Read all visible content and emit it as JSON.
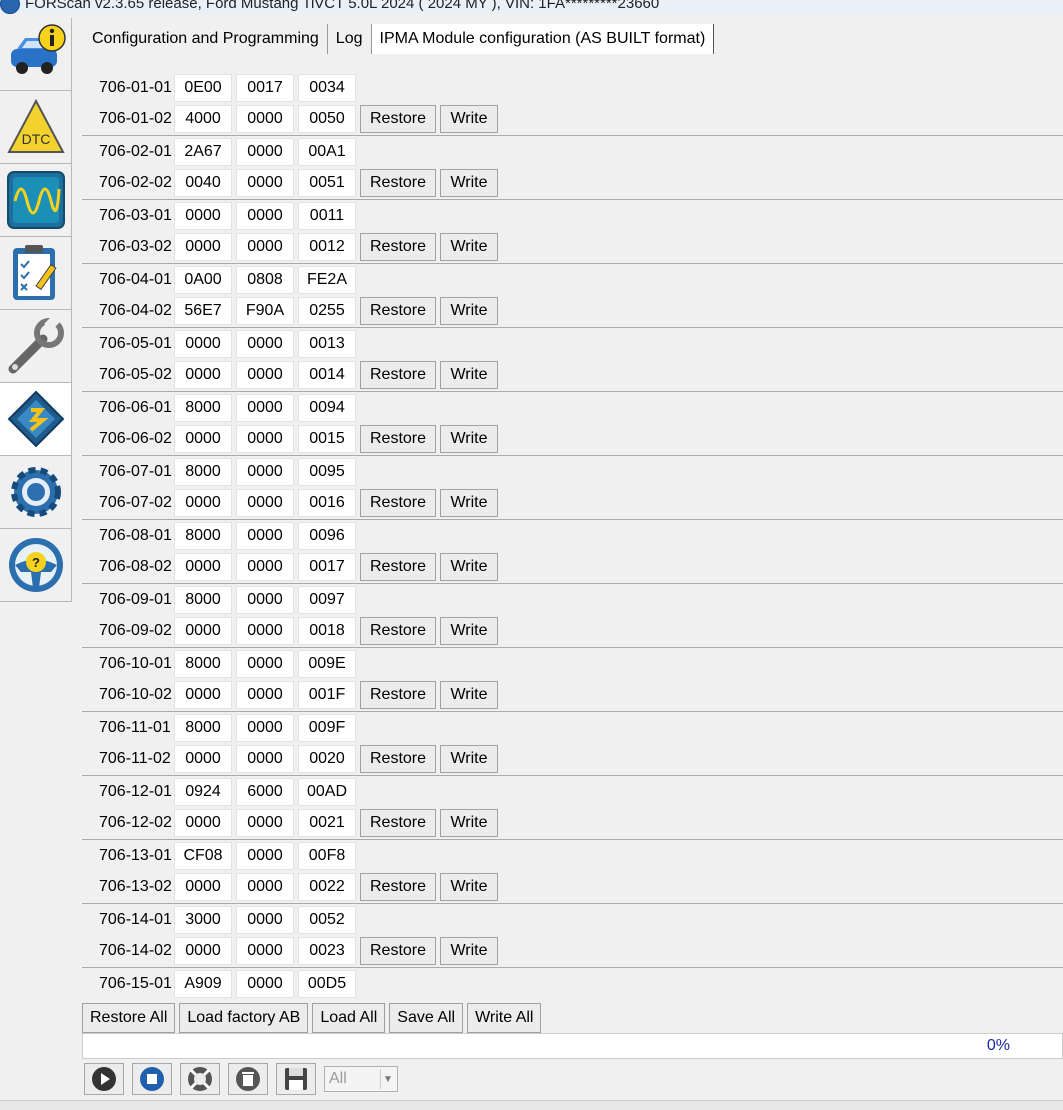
{
  "window": {
    "title": "FORScan v2.3.65 release, Ford Mustang TiVCT 5.0L 2024 ( 2024 MY ), VIN: 1FA*********23660"
  },
  "sidebar": {
    "items": [
      {
        "name": "vehicle-info"
      },
      {
        "name": "dtc"
      },
      {
        "name": "oscilloscope"
      },
      {
        "name": "tests-checklist"
      },
      {
        "name": "service-wrench"
      },
      {
        "name": "module-configuration",
        "active": true
      },
      {
        "name": "settings-gear"
      },
      {
        "name": "help"
      }
    ]
  },
  "tabs": [
    {
      "label": "Configuration and Programming"
    },
    {
      "label": "Log"
    },
    {
      "label": "IPMA Module configuration (AS BUILT format)",
      "active": true
    }
  ],
  "buttons": {
    "restore": "Restore",
    "write": "Write"
  },
  "rows": [
    {
      "a1": "706-01-01",
      "v1": [
        "0E00",
        "0017",
        "0034"
      ],
      "a2": "706-01-02",
      "v2": [
        "4000",
        "0000",
        "0050"
      ]
    },
    {
      "a1": "706-02-01",
      "v1": [
        "2A67",
        "0000",
        "00A1"
      ],
      "a2": "706-02-02",
      "v2": [
        "0040",
        "0000",
        "0051"
      ]
    },
    {
      "a1": "706-03-01",
      "v1": [
        "0000",
        "0000",
        "0011"
      ],
      "a2": "706-03-02",
      "v2": [
        "0000",
        "0000",
        "0012"
      ]
    },
    {
      "a1": "706-04-01",
      "v1": [
        "0A00",
        "0808",
        "FE2A"
      ],
      "a2": "706-04-02",
      "v2": [
        "56E7",
        "F90A",
        "0255"
      ]
    },
    {
      "a1": "706-05-01",
      "v1": [
        "0000",
        "0000",
        "0013"
      ],
      "a2": "706-05-02",
      "v2": [
        "0000",
        "0000",
        "0014"
      ]
    },
    {
      "a1": "706-06-01",
      "v1": [
        "8000",
        "0000",
        "0094"
      ],
      "a2": "706-06-02",
      "v2": [
        "0000",
        "0000",
        "0015"
      ]
    },
    {
      "a1": "706-07-01",
      "v1": [
        "8000",
        "0000",
        "0095"
      ],
      "a2": "706-07-02",
      "v2": [
        "0000",
        "0000",
        "0016"
      ]
    },
    {
      "a1": "706-08-01",
      "v1": [
        "8000",
        "0000",
        "0096"
      ],
      "a2": "706-08-02",
      "v2": [
        "0000",
        "0000",
        "0017"
      ]
    },
    {
      "a1": "706-09-01",
      "v1": [
        "8000",
        "0000",
        "0097"
      ],
      "a2": "706-09-02",
      "v2": [
        "0000",
        "0000",
        "0018"
      ]
    },
    {
      "a1": "706-10-01",
      "v1": [
        "8000",
        "0000",
        "009E"
      ],
      "a2": "706-10-02",
      "v2": [
        "0000",
        "0000",
        "001F"
      ]
    },
    {
      "a1": "706-11-01",
      "v1": [
        "8000",
        "0000",
        "009F"
      ],
      "a2": "706-11-02",
      "v2": [
        "0000",
        "0000",
        "0020"
      ]
    },
    {
      "a1": "706-12-01",
      "v1": [
        "0924",
        "6000",
        "00AD"
      ],
      "a2": "706-12-02",
      "v2": [
        "0000",
        "0000",
        "0021"
      ]
    },
    {
      "a1": "706-13-01",
      "v1": [
        "CF08",
        "0000",
        "00F8"
      ],
      "a2": "706-13-02",
      "v2": [
        "0000",
        "0000",
        "0022"
      ]
    },
    {
      "a1": "706-14-01",
      "v1": [
        "3000",
        "0000",
        "0052"
      ],
      "a2": "706-14-02",
      "v2": [
        "0000",
        "0000",
        "0023"
      ]
    },
    {
      "a1": "706-15-01",
      "v1": [
        "A909",
        "0000",
        "00D5"
      ]
    }
  ],
  "bottom_buttons": [
    "Restore All",
    "Load factory AB",
    "Load All",
    "Save All",
    "Write All"
  ],
  "progress": {
    "value": 0,
    "label": "0%"
  },
  "toolbar": {
    "icons": [
      "play-icon",
      "stop-icon",
      "lifebuoy-icon",
      "trash-icon",
      "save-icon"
    ],
    "filter_select": "All"
  }
}
